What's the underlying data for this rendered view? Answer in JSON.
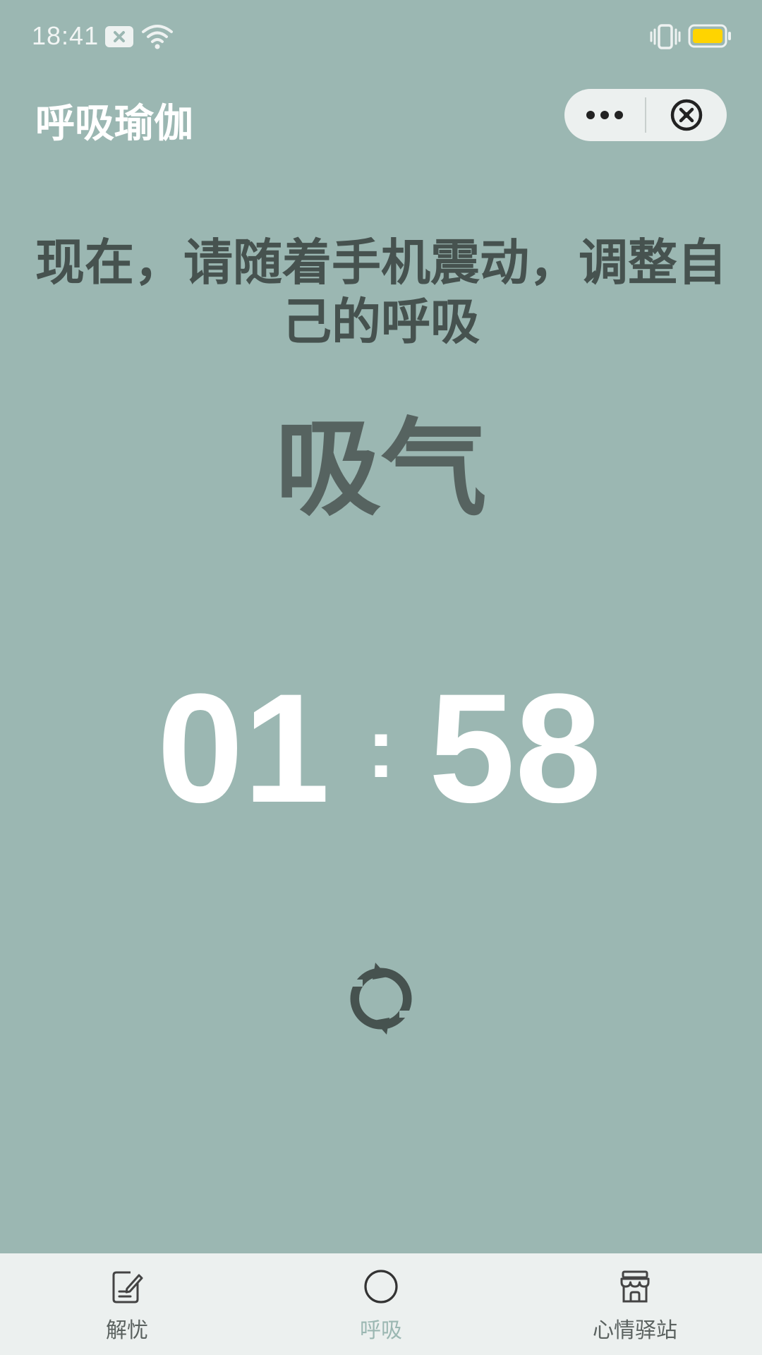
{
  "status_bar": {
    "time": "18:41",
    "icons": [
      "notification-icon",
      "wifi-icon",
      "vibrate-icon",
      "battery-icon"
    ],
    "battery_color": "#ffd400"
  },
  "header": {
    "title": "呼吸瑜伽",
    "more_icon": "more-dots-icon",
    "close_icon": "close-circle-icon"
  },
  "main": {
    "instruction": "现在，请随着手机震动，调整自己的呼吸",
    "phase": "吸气",
    "timer": {
      "minutes": "01",
      "separator": ":",
      "seconds": "58"
    },
    "refresh_icon": "refresh-icon"
  },
  "tabbar": {
    "items": [
      {
        "label": "解忧",
        "icon": "note-edit-icon",
        "active": false
      },
      {
        "label": "呼吸",
        "icon": "circle-icon",
        "active": true
      },
      {
        "label": "心情驿站",
        "icon": "store-icon",
        "active": false
      }
    ],
    "active_color": "#9bb7b2",
    "inactive_color": "#5b6260"
  },
  "colors": {
    "background": "#9bb7b2",
    "text_dark": "#46524f",
    "timer": "#ffffff"
  }
}
